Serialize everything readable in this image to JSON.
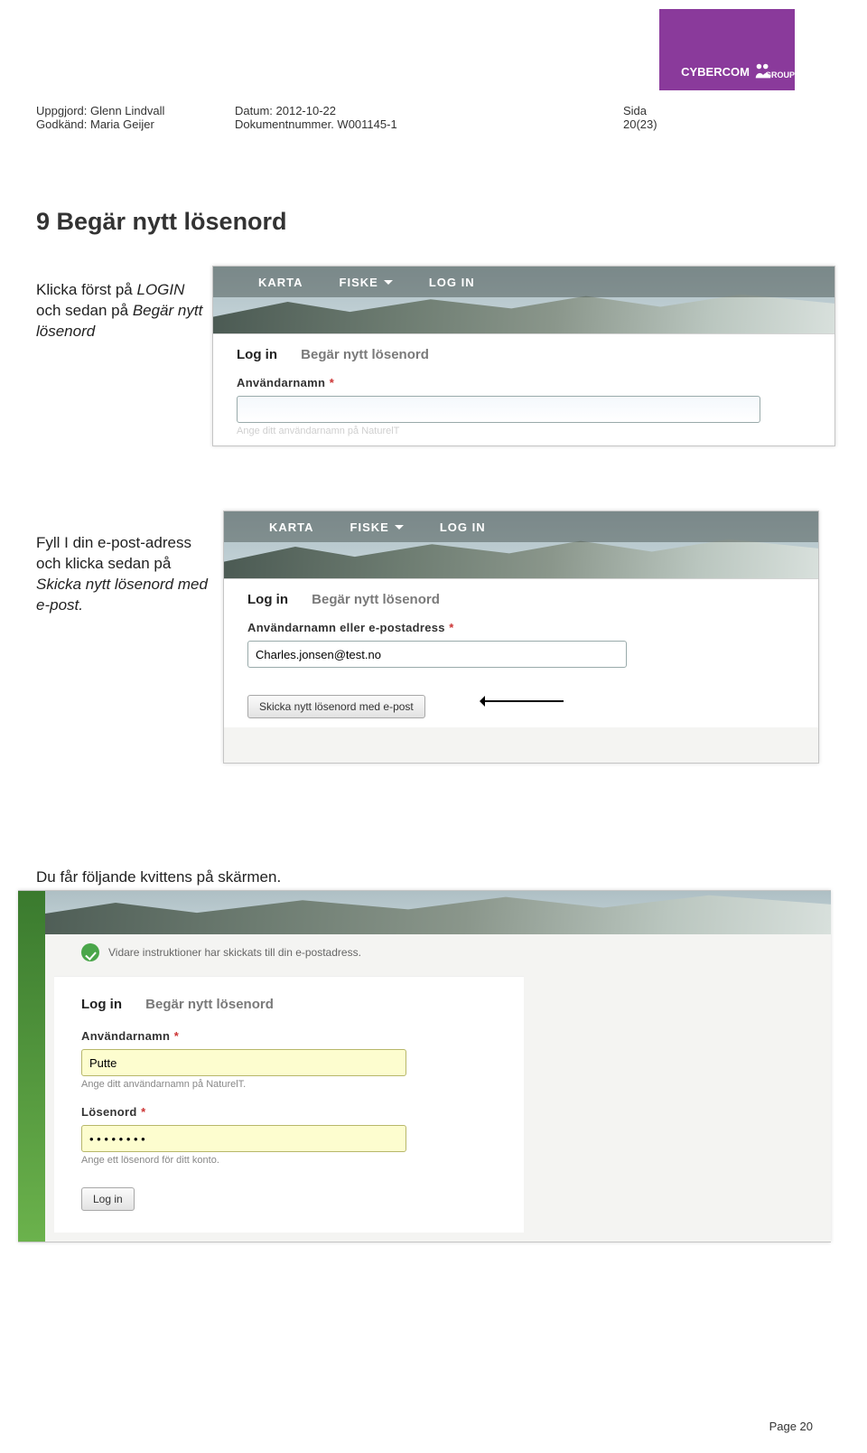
{
  "header": {
    "logo_text": "CYBERCOM",
    "logo_text2": "GROUP",
    "uppgjord_label": "Uppgjord: Glenn Lindvall",
    "godkand_label": "Godkänd: Maria Geijer",
    "datum_label": "Datum: 2012-10-22",
    "doknr_label": "Dokumentnummer. W001145-1",
    "sida_label": "Sida",
    "sida_value": "20(23)"
  },
  "heading": "9   Begär nytt lösenord",
  "text1_a": "Klicka först på ",
  "text1_b": "LOGIN",
  "text1_c": "och  sedan på ",
  "text1_d": "Begär nytt lösenord",
  "text2_a": "Fyll I din e-post-adress och klicka sedan på ",
  "text2_b": "Skicka nytt lösenord med e-post.",
  "text3": "Du får följande kvittens på skärmen.",
  "nav": {
    "item1": "KARTA",
    "item2": "FISKE",
    "item3": "LOG IN"
  },
  "form": {
    "tab_login": "Log in",
    "tab_reset": "Begär nytt lösenord",
    "user_label": "Användarnamn",
    "user_or_email_label": "Användarnamn eller e-postadress",
    "asterisk": "*",
    "hint_truncated": "Ange ditt användarnamn på NaturelT",
    "email_value": "Charles.jonsen@test.no",
    "submit_label": "Skicka nytt lösenord med e-post"
  },
  "confirm": {
    "message": "Vidare instruktioner har skickats till din e-postadress.",
    "user_label": "Användarnamn",
    "user_hint": "Ange ditt användarnamn på NaturelT.",
    "user_value": "Putte",
    "pass_label": "Lösenord",
    "pass_hint": "Ange ett lösenord för ditt konto.",
    "pass_value": "• • • • • • • •",
    "login_btn": "Log in"
  },
  "footer": "Page 20"
}
